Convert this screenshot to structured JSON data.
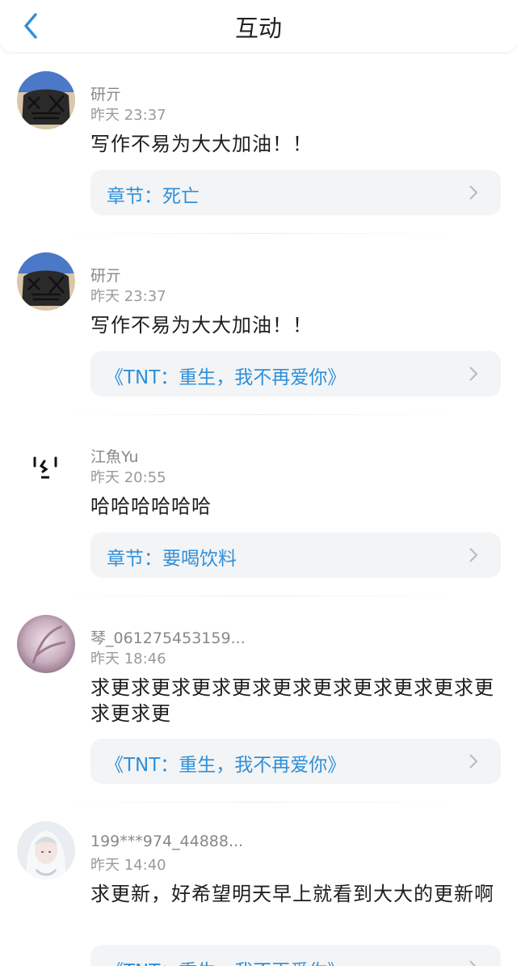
{
  "header": {
    "title": "互动",
    "back_icon": "chevron-left-icon"
  },
  "colors": {
    "accent": "#2f8fd8",
    "link_bg": "#f3f4f6"
  },
  "comments": [
    {
      "user": "研亓",
      "time": "昨天 23:37",
      "text": "写作不易为大大加油！！",
      "link": "章节：死亡"
    },
    {
      "user": "研亓",
      "time": "昨天 23:37",
      "text": "写作不易为大大加油！！",
      "link": "《TNT：重生，我不再爱你》"
    },
    {
      "user": "江魚Yu",
      "time": "昨天 20:55",
      "text": "哈哈哈哈哈哈",
      "link": "章节：要喝饮料"
    },
    {
      "user": "琴_061275453159...",
      "time": "昨天 18:46",
      "text": "求更求更求更求更求更求更求更求更求更求更求更求更",
      "link": "《TNT：重生，我不再爱你》"
    },
    {
      "user": "199***974_44888...",
      "time": "昨天 14:40",
      "text": "求更新，好希望明天早上就看到大大的更新啊",
      "link": "《TNT：重生，我不再爱你》"
    }
  ]
}
